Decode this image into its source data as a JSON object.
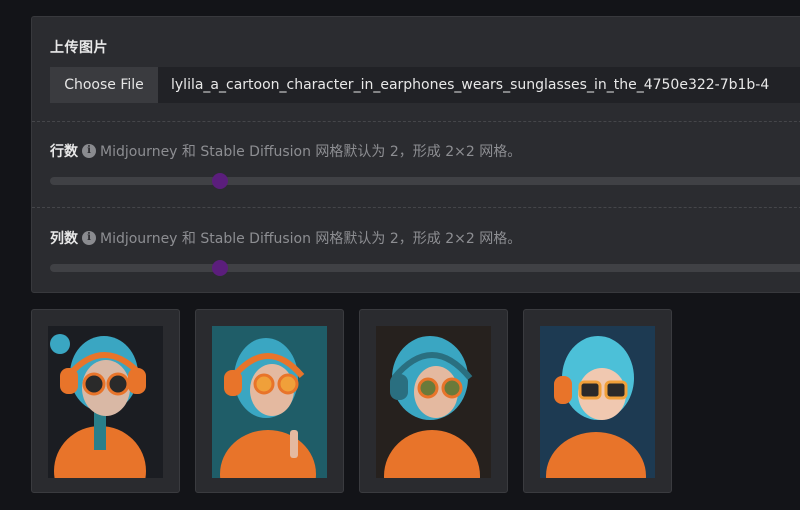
{
  "upload": {
    "label": "上传图片",
    "choose_button": "Choose File",
    "file_name": "lylila_a_cartoon_character_in_earphones_wears_sunglasses_in_the_4750e322-7b1b-4"
  },
  "rows": {
    "label": "行数",
    "hint": "Midjourney 和 Stable Diffusion 网格默认为 2，形成 2×2 网格。",
    "value": 2
  },
  "cols": {
    "label": "列数",
    "hint": "Midjourney 和 Stable Diffusion 网格默认为 2，形成 2×2 网格。",
    "value": 2
  },
  "colors": {
    "accent": "#5b1e7c",
    "panel": "#2b2c30",
    "background": "#131418"
  },
  "thumbnails": [
    {
      "name": "split-image-1"
    },
    {
      "name": "split-image-2"
    },
    {
      "name": "split-image-3"
    },
    {
      "name": "split-image-4"
    }
  ]
}
